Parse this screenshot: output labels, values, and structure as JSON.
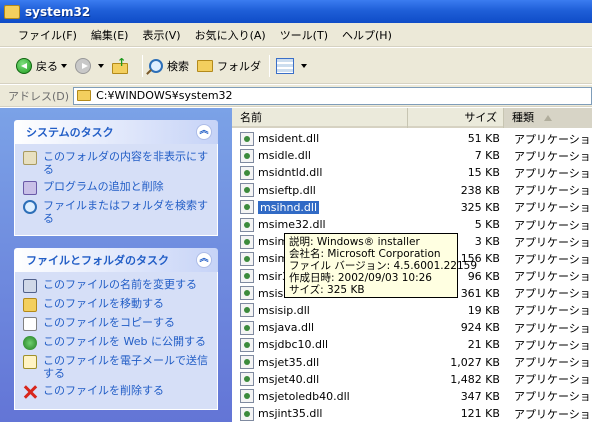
{
  "window": {
    "title": "system32"
  },
  "menu": [
    "ファイル(F)",
    "編集(E)",
    "表示(V)",
    "お気に入り(A)",
    "ツール(T)",
    "ヘルプ(H)"
  ],
  "toolbar": {
    "back": "戻る",
    "search": "検索",
    "folders": "フォルダ"
  },
  "address": {
    "label": "アドレス(D)",
    "path": "C:¥WINDOWS¥system32"
  },
  "system_tasks": {
    "title": "システムのタスク",
    "items": [
      {
        "label": "このフォルダの内容を非表示にする",
        "icon": "hide-contents-icon"
      },
      {
        "label": "プログラムの追加と削除",
        "icon": "add-remove-programs-icon"
      },
      {
        "label": "ファイルまたはフォルダを検索する",
        "icon": "search-icon"
      }
    ]
  },
  "file_tasks": {
    "title": "ファイルとフォルダのタスク",
    "items": [
      {
        "label": "このファイルの名前を変更する",
        "icon": "rename-icon"
      },
      {
        "label": "このファイルを移動する",
        "icon": "move-icon"
      },
      {
        "label": "このファイルをコピーする",
        "icon": "copy-icon"
      },
      {
        "label": "このファイルを Web に公開する",
        "icon": "web-publish-icon"
      },
      {
        "label": "このファイルを電子メールで送信する",
        "icon": "email-icon"
      },
      {
        "label": "このファイルを削除する",
        "icon": "delete-icon"
      }
    ]
  },
  "columns": {
    "name": "名前",
    "size": "サイズ",
    "type": "種類"
  },
  "files": [
    {
      "name": "msident.dll",
      "size": "51 KB",
      "type": "アプリケーション拡張"
    },
    {
      "name": "msidle.dll",
      "size": "7 KB",
      "type": "アプリケーション拡張"
    },
    {
      "name": "msidntld.dll",
      "size": "15 KB",
      "type": "アプリケーション拡張"
    },
    {
      "name": "msieftp.dll",
      "size": "238 KB",
      "type": "アプリケーション拡張"
    },
    {
      "name": "msihnd.dll",
      "size": "325 KB",
      "type": "アプリケーション拡張",
      "selected": true
    },
    {
      "name": "msime32.dll",
      "size": "5 KB",
      "type": "アプリケーション拡張"
    },
    {
      "name": "msim",
      "size": "3 KB",
      "type": "アプリケーション拡張"
    },
    {
      "name": "msim",
      "size": "156 KB",
      "type": "アプリケーション拡張"
    },
    {
      "name": "msir3",
      "size": "96 KB",
      "type": "アプリケーション拡張"
    },
    {
      "name": "msisa",
      "size": "361 KB",
      "type": "アプリケーション拡張"
    },
    {
      "name": "msisip.dll",
      "size": "19 KB",
      "type": "アプリケーション拡張"
    },
    {
      "name": "msjava.dll",
      "size": "924 KB",
      "type": "アプリケーション拡張"
    },
    {
      "name": "msjdbc10.dll",
      "size": "21 KB",
      "type": "アプリケーション拡張"
    },
    {
      "name": "msjet35.dll",
      "size": "1,027 KB",
      "type": "アプリケーション拡張"
    },
    {
      "name": "msjet40.dll",
      "size": "1,482 KB",
      "type": "アプリケーション拡張"
    },
    {
      "name": "msjetoledb40.dll",
      "size": "347 KB",
      "type": "アプリケーション拡張"
    },
    {
      "name": "msjint35.dll",
      "size": "121 KB",
      "type": "アプリケーション拡張"
    }
  ],
  "tooltip": {
    "lines": [
      "説明: Windows® installer",
      "会社名: Microsoft Corporation",
      "ファイル バージョン: 4.5.6001.22159",
      "作成日時: 2002/09/03 10:26",
      "サイズ: 325 KB"
    ]
  }
}
